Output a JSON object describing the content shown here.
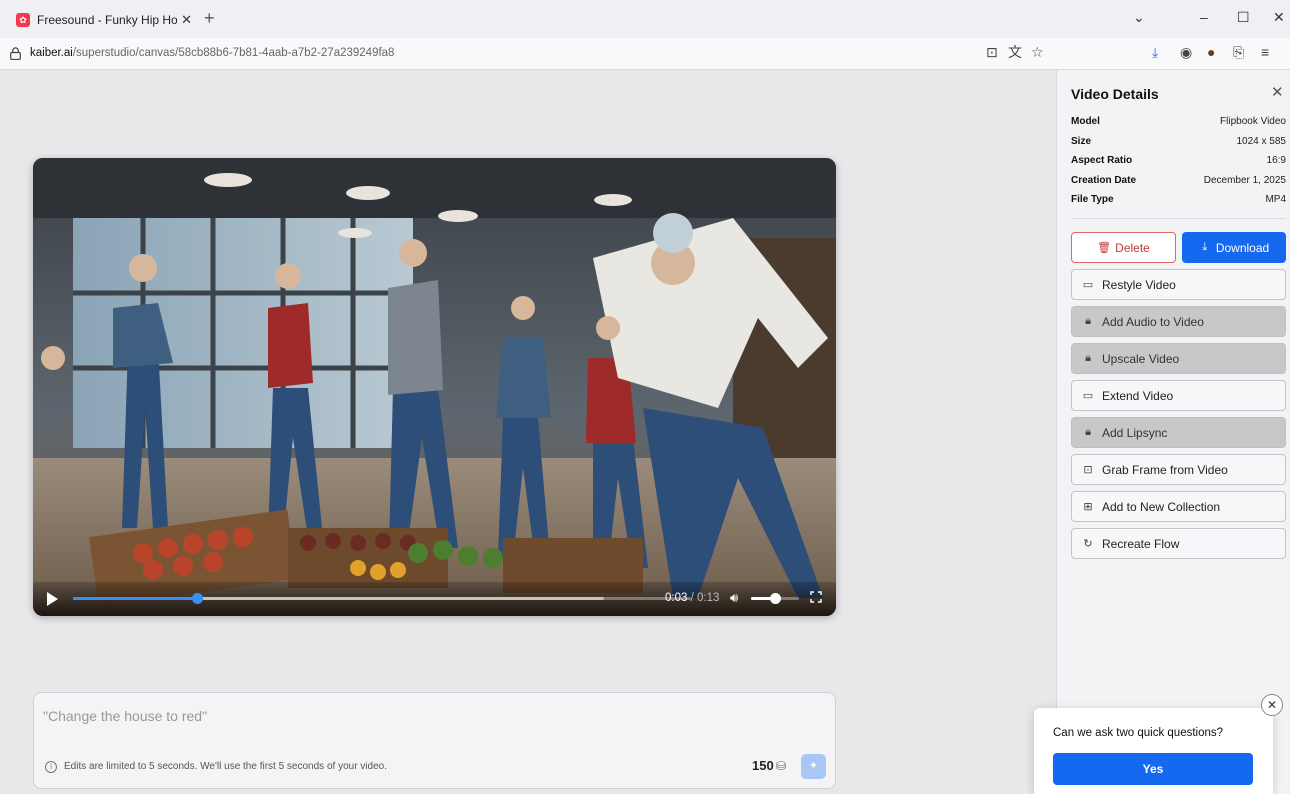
{
  "browser": {
    "tab_title": "Freesound - Funky Hip Hop Loc",
    "tab_close": "✕",
    "new_tab": "+",
    "url_domain": "kaiber.ai",
    "url_path": "/superstudio/canvas/58cb88b6-7b81-4aab-a7b2-27a239249fa8",
    "icons": [
      "lock-icon",
      "reader-view-icon",
      "translate-icon",
      "bookmark-star-icon",
      "downloads-icon",
      "account-icon",
      "extension-icon",
      "share-icon",
      "menu-icon"
    ]
  },
  "video": {
    "current_time": "0:03",
    "duration": "/ 0:13",
    "progress": 0.2,
    "buffered": 0.86,
    "volume": 0.5
  },
  "prompt": {
    "placeholder": "\"Change the house to red\"",
    "note": "Edits are limited to 5 seconds. We'll use the first 5 seconds of your video.",
    "credits": "150"
  },
  "panel": {
    "title": "Video Details",
    "details": [
      {
        "key": "Model",
        "value": "Flipbook Video"
      },
      {
        "key": "Size",
        "value": "1024 x 585"
      },
      {
        "key": "Aspect Ratio",
        "value": "16:9"
      },
      {
        "key": "Creation Date",
        "value": "December 1, 2025"
      },
      {
        "key": "File Type",
        "value": "MP4"
      }
    ],
    "delete_label": "Delete",
    "download_label": "Download",
    "actions": [
      {
        "label": "Restyle Video",
        "icon": "video-icon",
        "locked": false
      },
      {
        "label": "Add Audio to Video",
        "icon": "lock-icon",
        "locked": true
      },
      {
        "label": "Upscale Video",
        "icon": "lock-icon",
        "locked": true
      },
      {
        "label": "Extend Video",
        "icon": "video-icon",
        "locked": false
      },
      {
        "label": "Add Lipsync",
        "icon": "lock-icon",
        "locked": true
      },
      {
        "label": "Grab Frame from Video",
        "icon": "frame-icon",
        "locked": false
      },
      {
        "label": "Add to New Collection",
        "icon": "collection-add-icon",
        "locked": false
      },
      {
        "label": "Recreate Flow",
        "icon": "refresh-icon",
        "locked": false
      }
    ]
  },
  "survey": {
    "question": "Can we ask two quick questions?",
    "yes_label": "Yes"
  },
  "colors": {
    "accent_blue": "#1469f0",
    "delete_red": "#c43a3a",
    "progress_blue": "#3b8ef5",
    "tab_favicon": "#f03c4a"
  }
}
